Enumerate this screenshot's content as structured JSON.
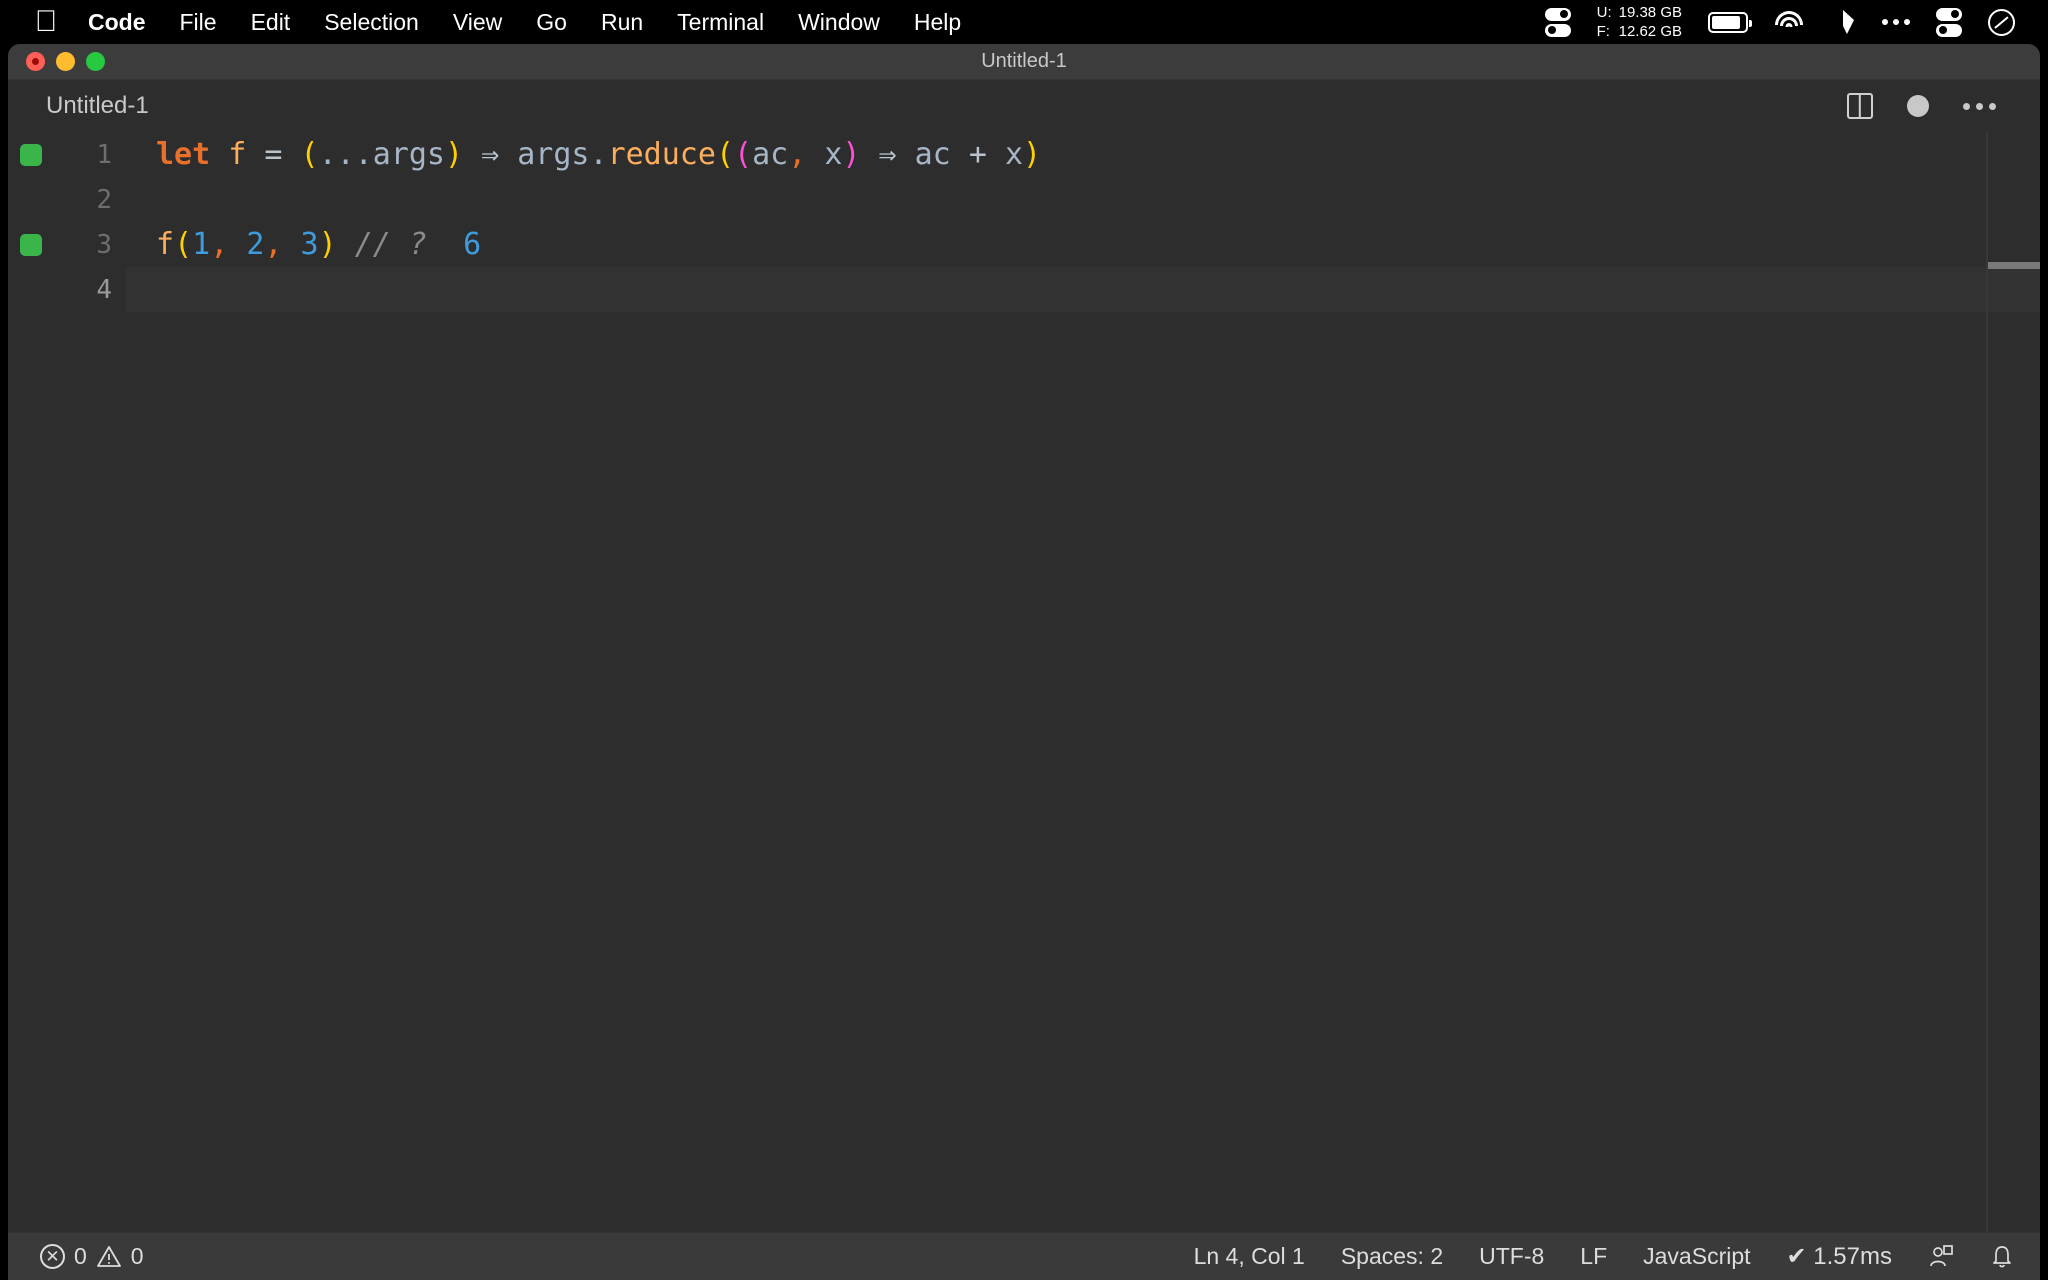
{
  "menubar": {
    "apple_icon": "apple-logo",
    "items": [
      {
        "label": "Code",
        "bold": true
      },
      {
        "label": "File",
        "bold": false
      },
      {
        "label": "Edit",
        "bold": false
      },
      {
        "label": "Selection",
        "bold": false
      },
      {
        "label": "View",
        "bold": false
      },
      {
        "label": "Go",
        "bold": false
      },
      {
        "label": "Run",
        "bold": false
      },
      {
        "label": "Terminal",
        "bold": false
      },
      {
        "label": "Window",
        "bold": false
      },
      {
        "label": "Help",
        "bold": false
      }
    ],
    "status_icons": {
      "memory_toggle_icon": "memory-toggle-icon",
      "memory": {
        "used_key": "U:",
        "used_value": "19.38 GB",
        "free_key": "F:",
        "free_value": "12.62 GB"
      },
      "battery_icon": "battery-icon",
      "wifi_icon": "wifi-icon",
      "dropbox_icon": "dropbox-icon",
      "ellipsis_icon": "ellipsis-icon",
      "toggles_icon": "toggles-icon",
      "control_center_icon": "control-center-icon"
    }
  },
  "window": {
    "title": "Untitled-1",
    "traffic_lights": [
      "close",
      "minimize",
      "maximize"
    ]
  },
  "tabbar": {
    "tabs": [
      {
        "label": "Untitled-1",
        "active": true,
        "dirty": true
      }
    ],
    "actions": {
      "split_editor": "split-editor-icon",
      "unsaved_indicator": "unsaved-dot-icon",
      "more_actions": "more-actions-icon"
    }
  },
  "editor": {
    "language": "JavaScript",
    "lines": [
      {
        "number": "1",
        "marker": true,
        "active": false,
        "tokens": [
          {
            "text": "let",
            "cls": "t-kw"
          },
          {
            "text": " ",
            "cls": "t-op"
          },
          {
            "text": "f",
            "cls": "t-fnvar"
          },
          {
            "text": " ",
            "cls": "t-op"
          },
          {
            "text": "=",
            "cls": "t-op"
          },
          {
            "text": " ",
            "cls": "t-op"
          },
          {
            "text": "(",
            "cls": "t-par1"
          },
          {
            "text": "...",
            "cls": "t-var"
          },
          {
            "text": "args",
            "cls": "t-var"
          },
          {
            "text": ")",
            "cls": "t-par1"
          },
          {
            "text": " ",
            "cls": "t-op"
          },
          {
            "text": "⇒",
            "cls": "t-arrow"
          },
          {
            "text": " ",
            "cls": "t-op"
          },
          {
            "text": "args",
            "cls": "t-var"
          },
          {
            "text": ".",
            "cls": "t-var"
          },
          {
            "text": "reduce",
            "cls": "t-method"
          },
          {
            "text": "(",
            "cls": "t-par1"
          },
          {
            "text": "(",
            "cls": "t-par2"
          },
          {
            "text": "ac",
            "cls": "t-var"
          },
          {
            "text": ",",
            "cls": "t-comma"
          },
          {
            "text": " ",
            "cls": "t-op"
          },
          {
            "text": "x",
            "cls": "t-var"
          },
          {
            "text": ")",
            "cls": "t-par2"
          },
          {
            "text": " ",
            "cls": "t-op"
          },
          {
            "text": "⇒",
            "cls": "t-arrow"
          },
          {
            "text": " ",
            "cls": "t-op"
          },
          {
            "text": "ac",
            "cls": "t-var"
          },
          {
            "text": " ",
            "cls": "t-op"
          },
          {
            "text": "+",
            "cls": "t-op"
          },
          {
            "text": " ",
            "cls": "t-op"
          },
          {
            "text": "x",
            "cls": "t-var"
          },
          {
            "text": ")",
            "cls": "t-par1"
          }
        ]
      },
      {
        "number": "2",
        "marker": false,
        "active": false,
        "tokens": []
      },
      {
        "number": "3",
        "marker": true,
        "active": false,
        "tokens": [
          {
            "text": "f",
            "cls": "t-fnvar"
          },
          {
            "text": "(",
            "cls": "t-par1"
          },
          {
            "text": "1",
            "cls": "t-num"
          },
          {
            "text": ",",
            "cls": "t-comma"
          },
          {
            "text": " ",
            "cls": "t-op"
          },
          {
            "text": "2",
            "cls": "t-num"
          },
          {
            "text": ",",
            "cls": "t-comma"
          },
          {
            "text": " ",
            "cls": "t-op"
          },
          {
            "text": "3",
            "cls": "t-num"
          },
          {
            "text": ")",
            "cls": "t-par1"
          },
          {
            "text": " ",
            "cls": "t-op"
          },
          {
            "text": "//",
            "cls": "t-comment"
          },
          {
            "text": " ",
            "cls": "t-op"
          },
          {
            "text": "?",
            "cls": "t-comment"
          },
          {
            "text": "  ",
            "cls": "t-op"
          },
          {
            "text": "6",
            "cls": "t-num"
          }
        ]
      },
      {
        "number": "4",
        "marker": false,
        "active": true,
        "tokens": []
      }
    ]
  },
  "statusbar": {
    "error_icon": "error-circle-icon",
    "error_count": "0",
    "warning_icon": "warning-triangle-icon",
    "warning_count": "0",
    "cursor_position": "Ln 4, Col 1",
    "indentation": "Spaces: 2",
    "encoding": "UTF-8",
    "eol": "LF",
    "language_mode": "JavaScript",
    "run_time": "✔ 1.57ms",
    "remote_icon": "remote-window-icon",
    "bell_icon": "notifications-bell-icon"
  },
  "colors": {
    "menubar_bg": "#000000",
    "titlebar_bg": "#3c3c3c",
    "editor_bg": "#2d2d2d",
    "active_line_bg": "#323232",
    "statusbar_bg": "#3a3a3a",
    "marker_green": "#3ab54a",
    "keyword_orange": "#e8702a",
    "bracket_yellow": "#ffd000",
    "bracket_magenta": "#ff4fd8",
    "number_blue": "#3e9cdd",
    "comment_gray": "#8a8a8a"
  }
}
